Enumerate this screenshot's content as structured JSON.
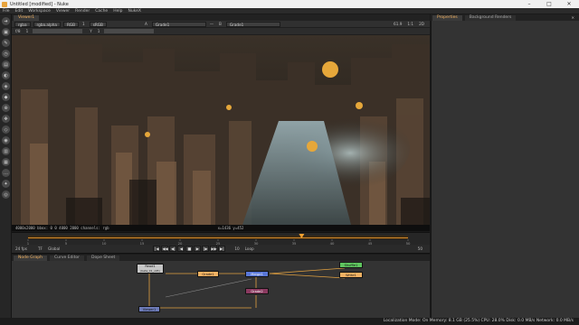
{
  "window": {
    "title": "Untitled [modified] - Nuke",
    "min_label": "–",
    "max_label": "□",
    "close_label": "✕"
  },
  "menu": [
    "File",
    "Edit",
    "Workspace",
    "Viewer",
    "Render",
    "Cache",
    "Help",
    "NukeX"
  ],
  "toolbar": {
    "icons": [
      "arrow-icon",
      "image-icon",
      "draw-icon",
      "time-icon",
      "channel-icon",
      "color-icon",
      "filter-icon",
      "keyer-icon",
      "merge-icon",
      "transform-icon",
      "3d-icon",
      "views-icon",
      "metadata-icon",
      "toolsets-icon",
      "other-icon",
      "furnace-icon",
      "ocula-icon"
    ],
    "glyphs": [
      "➜",
      "▣",
      "✎",
      "◷",
      "▤",
      "◐",
      "◈",
      "◆",
      "⊕",
      "✥",
      "◇",
      "◉",
      "▥",
      "▦",
      "…",
      "✦",
      "◎"
    ]
  },
  "viewer": {
    "tab_label": "Viewer1",
    "channels": "rgba",
    "alpha": "rgba.alpha",
    "colorspace": "RGB",
    "colorspace2": "sRGB",
    "frame_field": "1",
    "a_input": "A",
    "a_node": "Grade1",
    "b_input": "B",
    "b_node": "Grade1",
    "zoom": "61.9",
    "ratio": "1:1",
    "gain_label": "f/8",
    "gain_value": "1",
    "gamma_label": "Y",
    "gamma_value": "1",
    "mode": "2D",
    "info_text": "4000x2000  bbox: 0 0 4000 2000 channels: rgb",
    "coord_text": "x=1436 y=452"
  },
  "timeline": {
    "fps_label": "24 fps",
    "tf_label": "TF",
    "global_label": "Global",
    "ticks": [
      "1",
      "5",
      "10",
      "15",
      "20",
      "25",
      "30",
      "35",
      "40",
      "45",
      "50"
    ],
    "current_frame": 0.72,
    "end_frame": "50",
    "step_value": "10"
  },
  "playback": {
    "buttons": [
      "|◀",
      "◀◀",
      "◀|",
      "◀",
      "■",
      "▶",
      "|▶",
      "▶▶",
      "▶|"
    ],
    "icons": [
      "first-frame-icon",
      "rewind-icon",
      "prev-key-icon",
      "play-back-icon",
      "stop-icon",
      "play-icon",
      "next-key-icon",
      "fast-forward-icon",
      "last-frame-icon"
    ],
    "loop_label": "Loop"
  },
  "nodegraph": {
    "tabs": [
      "Node Graph",
      "Curve Editor",
      "Dope Sheet"
    ],
    "nodes": {
      "read": "Read1",
      "read_sub": "(beta_01_v05)",
      "grade1": "Grade1",
      "grade2": "Grade2",
      "merge": "Merge1",
      "write": "Write1",
      "shuffle": "Shuffle1",
      "viewer": "Viewer1"
    },
    "colors": {
      "read": "#c6c6c6",
      "grade": "#f2b263",
      "merge": "#5a78d8",
      "write": "#8a3a60",
      "green": "#5fc55f",
      "viewer": "#6d7bb8"
    }
  },
  "properties": {
    "tab1": "Properties",
    "tab2": "Background Renders",
    "tab_close": "✕"
  },
  "status": {
    "text": "Localization Mode: On  Memory: 8.1 GB (25.5%)  CPU: 28.0%  Disk: 0.0 MB/s  Network: 0.0 MB/s"
  }
}
